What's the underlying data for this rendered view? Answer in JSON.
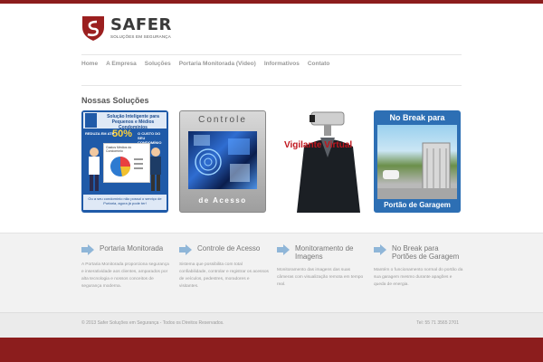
{
  "brand": {
    "name": "SAFER",
    "tagline": "SOLUÇÕES EM SEGURANÇA",
    "colors": {
      "accent": "#8c1d1d",
      "shield": "#9b1f1f"
    }
  },
  "nav": {
    "items": [
      {
        "label": "Home"
      },
      {
        "label": "A Empresa"
      },
      {
        "label": "Soluções"
      },
      {
        "label": "Portaria Monitorada (Video)"
      },
      {
        "label": "Informativos"
      },
      {
        "label": "Contato"
      }
    ]
  },
  "solutions": {
    "title": "Nossas Soluções",
    "cards": [
      {
        "icon": "brochure-image",
        "header": "Solução Inteligente para Pequenos e Médios Condomínios",
        "promo_left": "REDUZA EM ATÉ",
        "percent": "50%",
        "promo_right": "O CUSTO DO SEU CONDOMÍNIO",
        "board_title": "Gastos Médios do Condomínio",
        "footer": "Ou a seu condomínio não possui o serviço de Portaria, agora já pode ter!"
      },
      {
        "icon": "access-control-image",
        "title": "Controle",
        "footer": "de Acesso"
      },
      {
        "icon": "virtual-guard-image",
        "title": "Vigilante Virtual"
      },
      {
        "icon": "garage-gate-image",
        "title": "No Break para",
        "footer": "Portão de Garagem"
      }
    ]
  },
  "features": [
    {
      "icon": "arrow-right-icon",
      "title": "Portaria Monitorada",
      "text": "A Portaria Monitorada proporciona segurança e inseratividade aos clientes, amparados por alta tecnologia e nossos conceitos de segurança moderna."
    },
    {
      "icon": "arrow-right-icon",
      "title": "Controle de Acesso",
      "text": "Sistema que possibilita com total confiabilidade, controlar e registrar os acessos de veículos, pedestres, moradores e visitantes."
    },
    {
      "icon": "arrow-right-icon",
      "title": "Monitoramento de Imagens",
      "text": "Monitoramento das imagens das suas câmeras com visualização remota em tempo real."
    },
    {
      "icon": "arrow-right-icon",
      "title": "No Break para Portões de Garagem",
      "text": "Mantém o funcionamento normal do portão da sua garagem mesmo durante apagões e queda de energia."
    }
  ],
  "footer": {
    "copyright": "© 2013 Safer Soluções em Segurança - Todos os Direitos Reservados.",
    "phone": "Tel: 55 71 3565 2701"
  }
}
